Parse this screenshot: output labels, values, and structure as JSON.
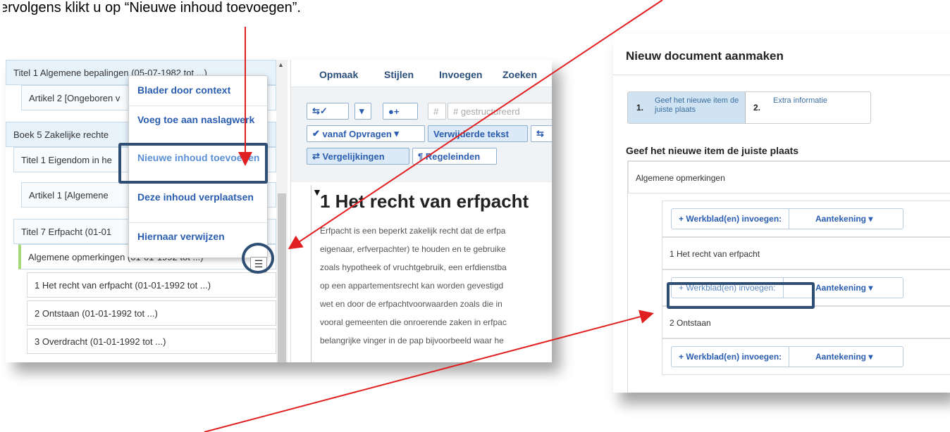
{
  "caption": "ervolgens klikt u op “Nieuwe inhoud toevoegen”.",
  "colors": {
    "accent": "#2a5db0",
    "highlight_box": "#2f4e74",
    "arrow": "#e02020",
    "tree_bg": "#e7f2fb",
    "step_active": "#cfe3f2"
  },
  "left_window": {
    "tree": [
      "Titel 1 Algemene bepalingen (05-07-1982 tot ...)",
      "Artikel 2 [Ongeboren v",
      "Boek 5 Zakelijke rechte",
      "Titel 1 Eigendom in he",
      "Artikel 1 [Algemene",
      "Titel 7 Erfpacht (01-01",
      "Algemene opmerkingen (01-01-1992 tot ...)",
      "1 Het recht van erfpacht (01-01-1992 tot ...)",
      "2 Ontstaan (01-01-1992 tot ...)",
      "3 Overdracht (01-01-1992 tot ...)"
    ],
    "context_menu": [
      "Blader door context",
      "Voeg toe aan naslagwerk",
      "Nieuwe inhoud toevoegen",
      "Deze inhoud verplaatsen",
      "Hiernaar verwijzen"
    ],
    "menu_button_icon": "hamburger-icon",
    "editor": {
      "menubar": [
        "Opmaak",
        "Stijlen",
        "Invoegen",
        "Zoeken"
      ],
      "toolbar": {
        "structured": "# gestructureerd",
        "hash": "#",
        "from_requests": "vanaf Opvragen",
        "deleted_text": "Verwijderde tekst",
        "comparisons": "Vergelijkingen",
        "line_endings": "Regeleinden"
      },
      "doc_title": "1 Het recht van erfpacht",
      "doc_lines": [
        "Erfpacht is een beperkt zakelijk recht dat de erfpa",
        "eigenaar, erfverpachter) te houden en te gebruike",
        "zoals hypotheek of vruchtgebruik, een erfdienstba",
        "op een appartementsrecht kan worden gevestigd",
        "wet en door de erfpachtvoorwaarden zoals die in",
        "vooral gemeenten die onroerende zaken in erfpac",
        "belangrijke vinger in de pap bijvoorbeeld waar he"
      ]
    }
  },
  "right_window": {
    "title": "Nieuw document aanmaken",
    "steps": [
      {
        "num": "1.",
        "label": "Geef het nieuwe item de juiste plaats"
      },
      {
        "num": "2.",
        "label": "Extra informatie"
      }
    ],
    "section_label": "Geef het nieuwe item de juiste plaats",
    "rows": [
      "Algemene opmerkingen",
      "1 Het recht van erfpacht",
      "2 Ontstaan"
    ],
    "insert_button": "+ Werkblad(en) invoegen:",
    "note_button": "Aantekening ▾"
  }
}
